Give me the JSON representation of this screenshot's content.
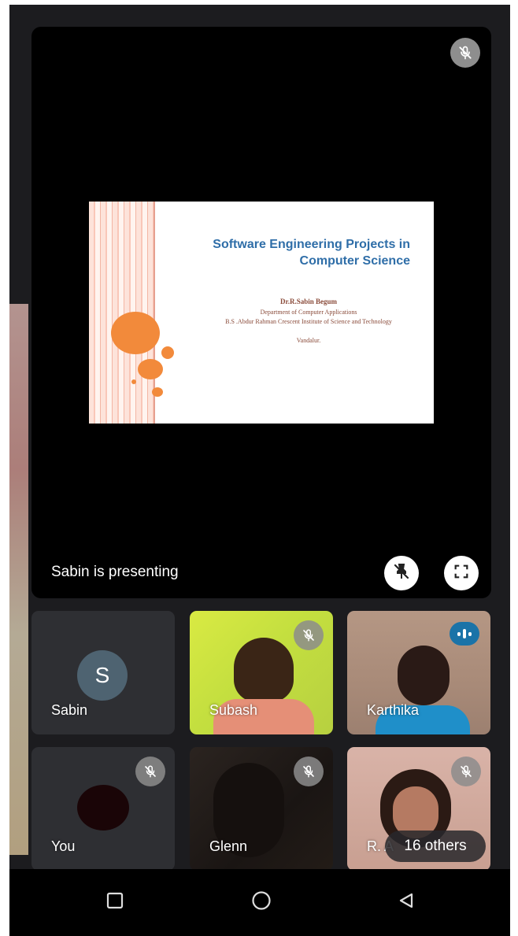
{
  "presentation": {
    "status_text": "Sabin is presenting",
    "slide": {
      "title": "Software Engineering Projects in Computer Science",
      "author_lines": [
        "Dr.R.Sabin Begum",
        "Department of Computer Applications",
        "B.S .Abdur Rahman Crescent Institute of Science and Technology",
        "Vandalur."
      ]
    }
  },
  "participants": [
    {
      "name": "Sabin",
      "initial": "S",
      "muted": false
    },
    {
      "name": "Subash",
      "muted": true
    },
    {
      "name": "Karthika",
      "muted": false,
      "speaking": true
    },
    {
      "name": "You",
      "muted": true
    },
    {
      "name": "Glenn",
      "muted": true
    },
    {
      "name": "R. A",
      "muted": true
    }
  ],
  "others": {
    "label": "16 others"
  },
  "colors": {
    "accent_blue": "#1a73a8",
    "slide_title": "#2f6ea8",
    "slide_dots": "#f28a3b"
  },
  "icons": {
    "stage_mic": "mic-off-icon",
    "unpin": "pin-off-icon",
    "fullscreen": "fullscreen-icon",
    "nav_recents": "square-icon",
    "nav_home": "circle-icon",
    "nav_back": "triangle-back-icon"
  }
}
